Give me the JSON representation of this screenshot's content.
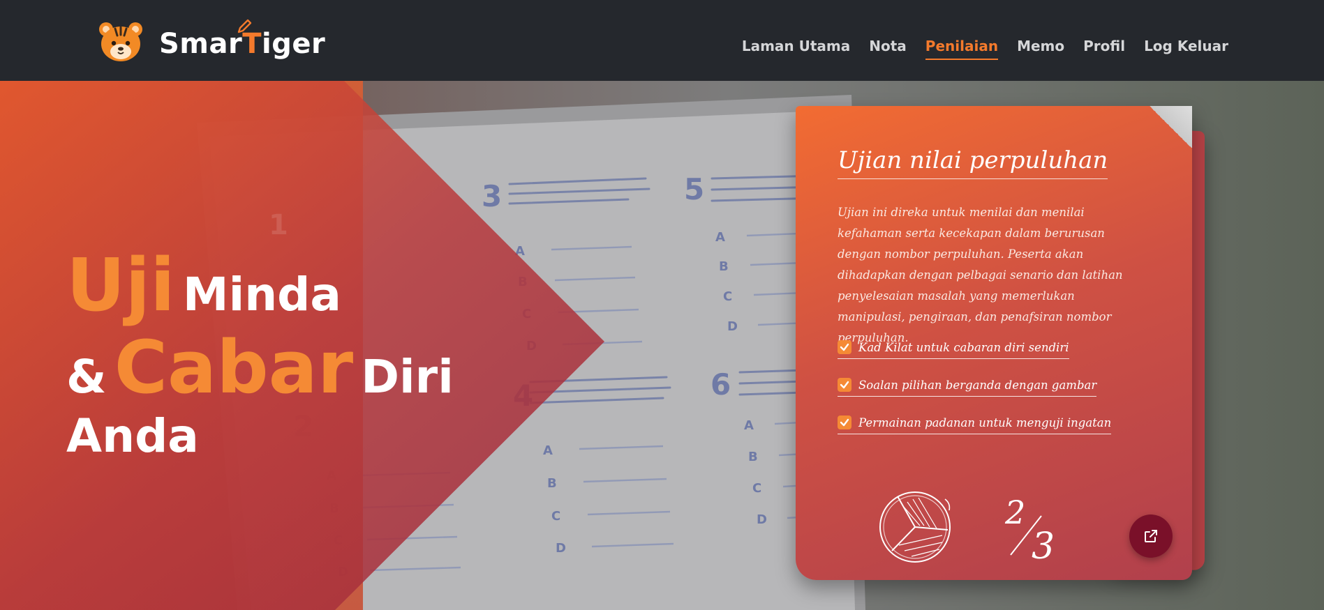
{
  "brand": {
    "name_part1": "Smar",
    "name_accent": "T",
    "name_part2": "iger"
  },
  "nav": {
    "items": [
      {
        "label": "Laman Utama"
      },
      {
        "label": "Nota"
      },
      {
        "label": "Penilaian",
        "active": true
      },
      {
        "label": "Memo"
      },
      {
        "label": "Profil"
      },
      {
        "label": "Log Keluar"
      }
    ]
  },
  "hero": {
    "word1": "Uji",
    "word2": "Minda",
    "word3": "&",
    "word4": "Cabar",
    "word5": "Diri",
    "word6": "Anda"
  },
  "card": {
    "title": "Ujian nilai perpuluhan",
    "description": "Ujian ini direka untuk menilai dan menilai kefahaman serta kecekapan dalam berurusan dengan nombor perpuluhan. Peserta akan dihadapkan dengan pelbagai senario dan latihan penyelesaian masalah yang memerlukan manipulasi, pengiraan, dan penafsiran nombor perpuluhan.",
    "features": [
      "Kad Kilat untuk cabaran diri sendiri",
      "Soalan pilihan berganda dengan gambar",
      "Permainan padanan untuk menguji ingatan"
    ],
    "fraction_num": "2",
    "fraction_den": "3",
    "share_icon": "external-link-icon"
  },
  "colors": {
    "accent": "#f47a2c",
    "header_bg": "#25282d",
    "card_top": "#f26c32",
    "card_bottom": "#b1404c",
    "share_button": "#7a1029"
  }
}
